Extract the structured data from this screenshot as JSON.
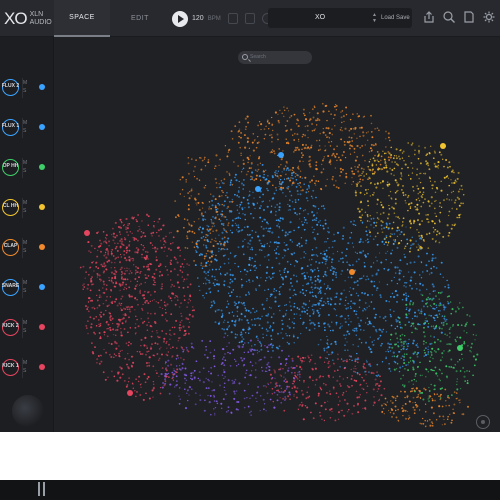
{
  "app": {
    "logo": "XO",
    "brand_line1": "XLN",
    "brand_line2": "AUDIO"
  },
  "tabs": {
    "space": "SPACE",
    "edit": "EDIT"
  },
  "transport": {
    "bpm": "120",
    "bpm_unit": "BPM"
  },
  "preset": {
    "name": "XO",
    "load_label": "Load",
    "save_label": "Save"
  },
  "search": {
    "placeholder": "Search"
  },
  "slots": [
    {
      "label": "FLUX 2",
      "mute": "M",
      "solo": "S",
      "color": "#3aa3ff"
    },
    {
      "label": "FLUX 1",
      "mute": "M",
      "solo": "S",
      "color": "#3aa3ff"
    },
    {
      "label": "OP HH",
      "mute": "M",
      "solo": "S",
      "color": "#3ecf6a"
    },
    {
      "label": "CL HH",
      "mute": "M",
      "solo": "S",
      "color": "#f2c530"
    },
    {
      "label": "CLAP",
      "mute": "M",
      "solo": "S",
      "color": "#f08a2c"
    },
    {
      "label": "SNARE",
      "mute": "M",
      "solo": "S",
      "color": "#3aa3ff"
    },
    {
      "label": "KICK 2",
      "mute": "M",
      "solo": "S",
      "color": "#e6455f"
    },
    {
      "label": "KICK 1",
      "mute": "M",
      "solo": "S",
      "color": "#e6455f"
    }
  ],
  "colors": {
    "blue": "#3aa3ff",
    "yellow": "#f2c530",
    "orange": "#f08a2c",
    "red": "#e6455f",
    "green": "#3ecf6a",
    "purple": "#8a5cf0"
  }
}
